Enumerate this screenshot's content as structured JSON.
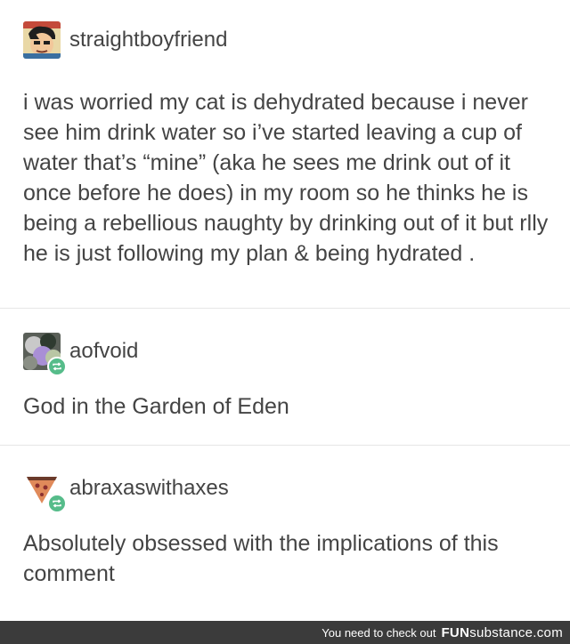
{
  "posts": [
    {
      "username": "straightboyfriend",
      "text": "i was worried my cat is dehydrated because i never see him drink water so i’ve started leaving a cup of water that’s “mine” (aka he sees me drink out of it once before he does) in my room so he thinks he is being a rebellious naughty by drinking out of it but rlly he is just following my plan & being hydrated ."
    },
    {
      "username": "aofvoid",
      "text": "God in the Garden of Eden"
    },
    {
      "username": "abraxaswithaxes",
      "text": "Absolutely obsessed with the implications of this comment"
    }
  ],
  "footer": {
    "message": "You need to check out",
    "brand_prefix": "FUN",
    "brand_suffix": "substance.com"
  },
  "colors": {
    "text": "#444444",
    "divider": "#e6e6e6",
    "reblog_badge": "#56bc8a",
    "footer_bg": "#3b3b3b"
  }
}
